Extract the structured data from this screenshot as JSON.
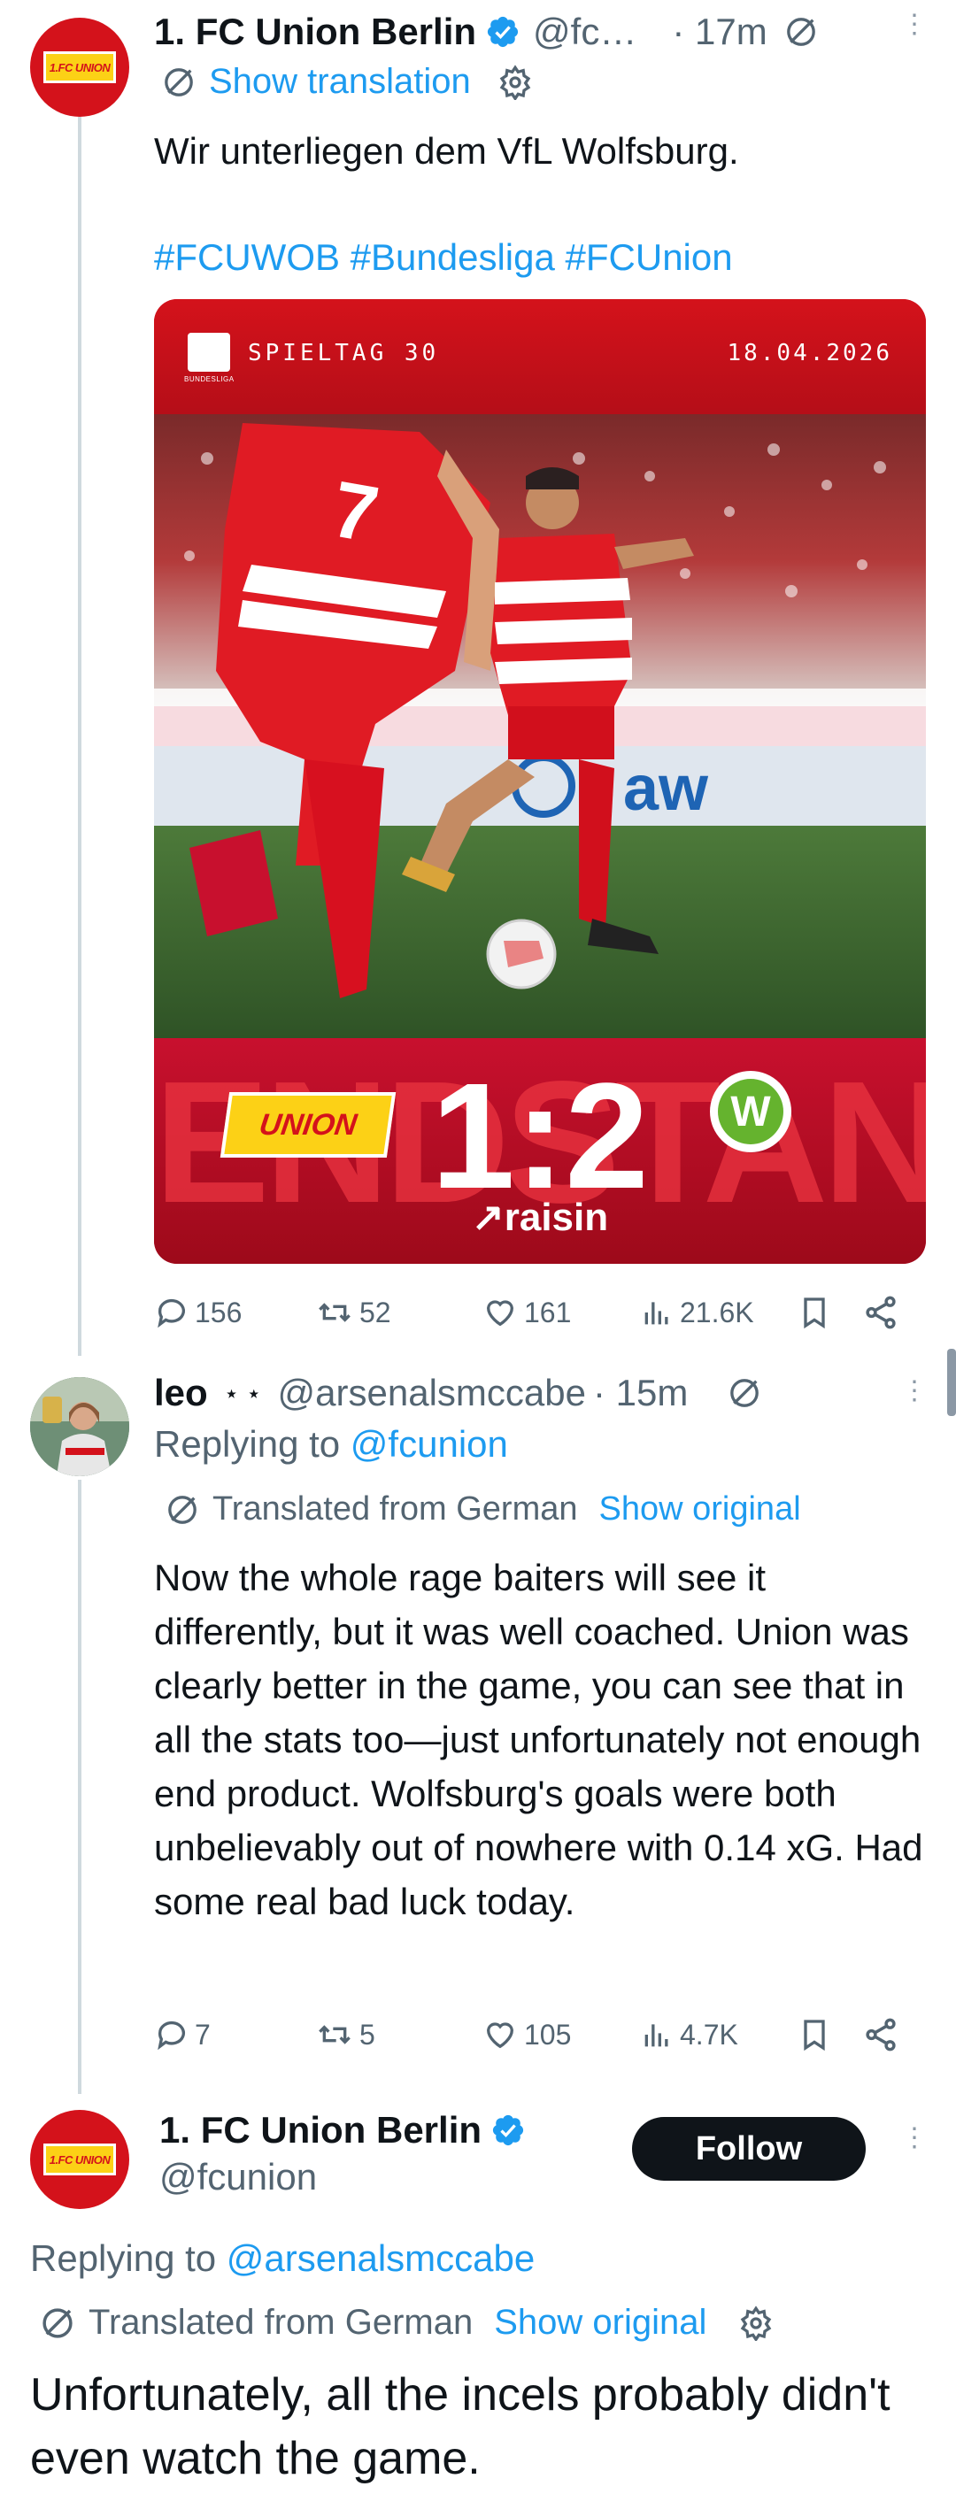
{
  "tweet1": {
    "name": "1. FC Union Berlin",
    "handle": "@fc…",
    "time": "· 17m",
    "show_translation": "Show translation",
    "text": "Wir unterliegen dem VfL Wolfsburg.",
    "hashtags": "#FCUWOB #Bundesliga #FCUnion",
    "media": {
      "matchday": "SPIELTAG 30",
      "date": "18.04.2026",
      "league_small": "BUNDESLIGA",
      "score": "1:2",
      "watermark": "ENDSTAND",
      "sponsor": "↗raisin",
      "shirt_number": "7",
      "board_text": "aw",
      "union_badge": "UNION",
      "wolfsburg_badge": "W"
    },
    "stats": {
      "replies": "156",
      "reposts": "52",
      "likes": "161",
      "views": "21.6K"
    }
  },
  "tweet2": {
    "name": "leo",
    "stars": "⋆ ⋆",
    "handle": "@arsenalsmccabe",
    "time": "· 15m",
    "replying_prefix": "Replying to ",
    "replying_to": "@fcunion",
    "translated_label": "Translated from German",
    "show_original": "Show original",
    "text": "Now the whole rage baiters will see it differently, but it was well coached. Union was clearly better in the game, you can see that in all the stats too—just unfortunately not enough end product. Wolfsburg's goals were both unbelievably out of nowhere with 0.14 xG. Had some real bad luck today.",
    "stats": {
      "replies": "7",
      "reposts": "5",
      "likes": "105",
      "views": "4.7K"
    }
  },
  "tweet3": {
    "name": "1. FC Union Berlin",
    "handle": "@fcunion",
    "follow_label": "Follow",
    "replying_prefix": "Replying to ",
    "replying_to": "@arsenalsmccabe",
    "translated_label": "Translated from German",
    "show_original": "Show original",
    "text": "Unfortunately, all the incels probably didn't even watch the game."
  },
  "colors": {
    "accent": "#1d9bf0",
    "union_red": "#d4121b",
    "verified": "#1d9bf0",
    "text_gray": "#536471"
  }
}
